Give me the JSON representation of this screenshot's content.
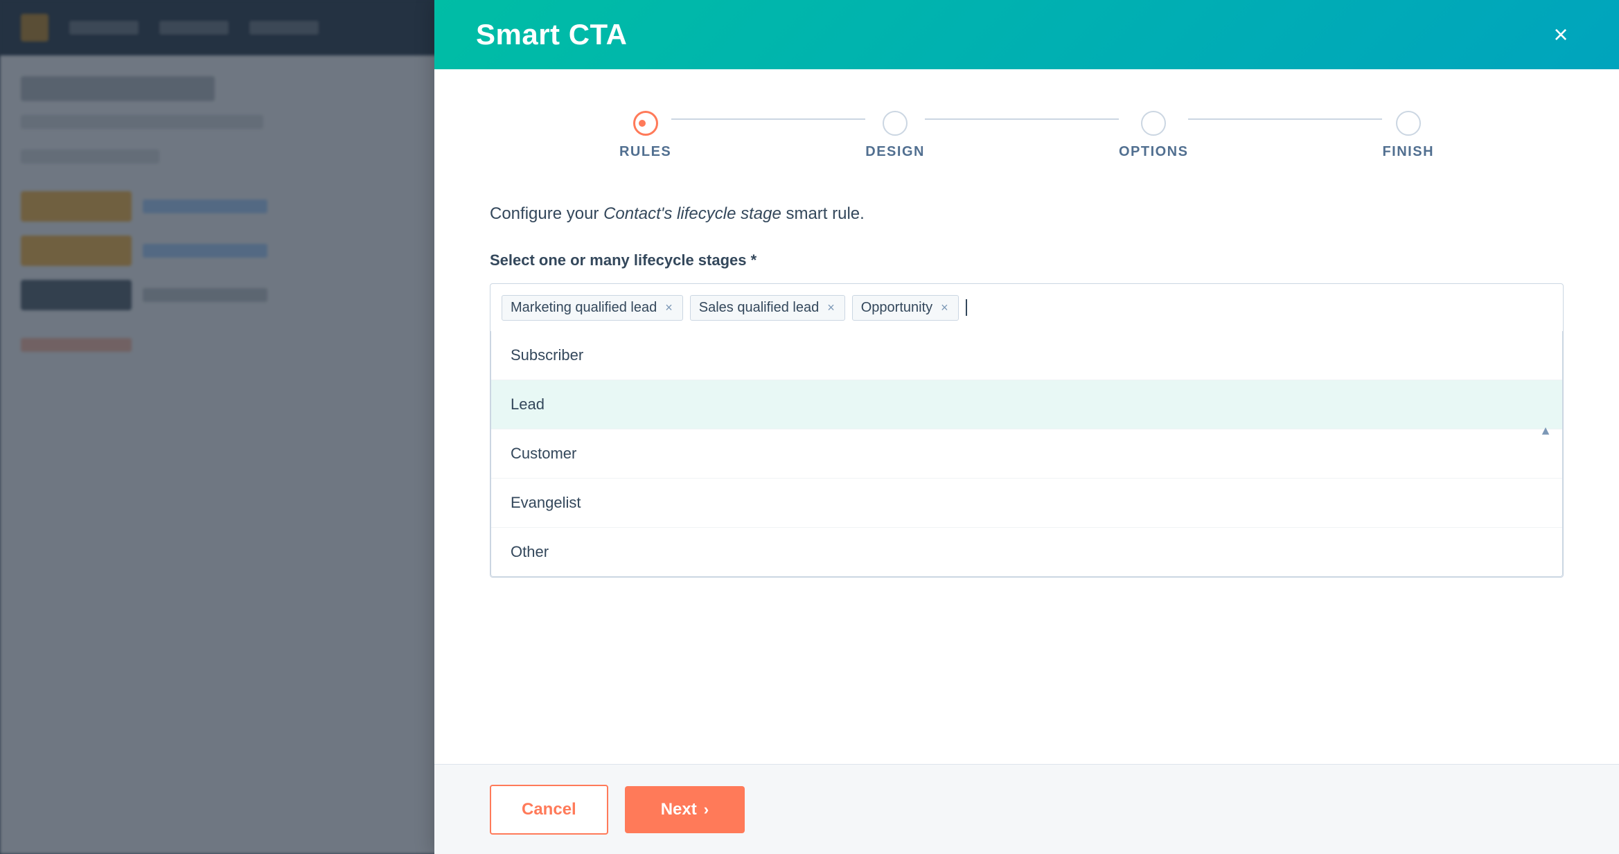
{
  "modal": {
    "title": "Smart CTA",
    "close_label": "×"
  },
  "stepper": {
    "steps": [
      {
        "id": "rules",
        "label": "RULES",
        "active": true
      },
      {
        "id": "design",
        "label": "DESIGN",
        "active": false
      },
      {
        "id": "options",
        "label": "OPTIONS",
        "active": false
      },
      {
        "id": "finish",
        "label": "FINISH",
        "active": false
      }
    ]
  },
  "description": {
    "text_before": "Configure your ",
    "italic": "Contact's lifecycle stage",
    "text_after": " smart rule."
  },
  "section": {
    "label": "Select one or many lifecycle stages *"
  },
  "tags": [
    {
      "id": "mql",
      "label": "Marketing qualified lead"
    },
    {
      "id": "sql",
      "label": "Sales qualified lead"
    },
    {
      "id": "opp",
      "label": "Opportunity"
    }
  ],
  "dropdown": {
    "items": [
      {
        "id": "subscriber",
        "label": "Subscriber",
        "highlighted": false
      },
      {
        "id": "lead",
        "label": "Lead",
        "highlighted": true
      },
      {
        "id": "customer",
        "label": "Customer",
        "highlighted": false
      },
      {
        "id": "evangelist",
        "label": "Evangelist",
        "highlighted": false
      },
      {
        "id": "other",
        "label": "Other",
        "highlighted": false
      }
    ]
  },
  "footer": {
    "cancel_label": "Cancel",
    "next_label": "Next",
    "next_arrow": "›"
  },
  "colors": {
    "accent": "#ff7a59",
    "teal": "#00bda5",
    "step_active": "#ff7a59",
    "step_inactive": "#cbd6e2",
    "text_dark": "#33475b",
    "text_medium": "#516f90"
  }
}
